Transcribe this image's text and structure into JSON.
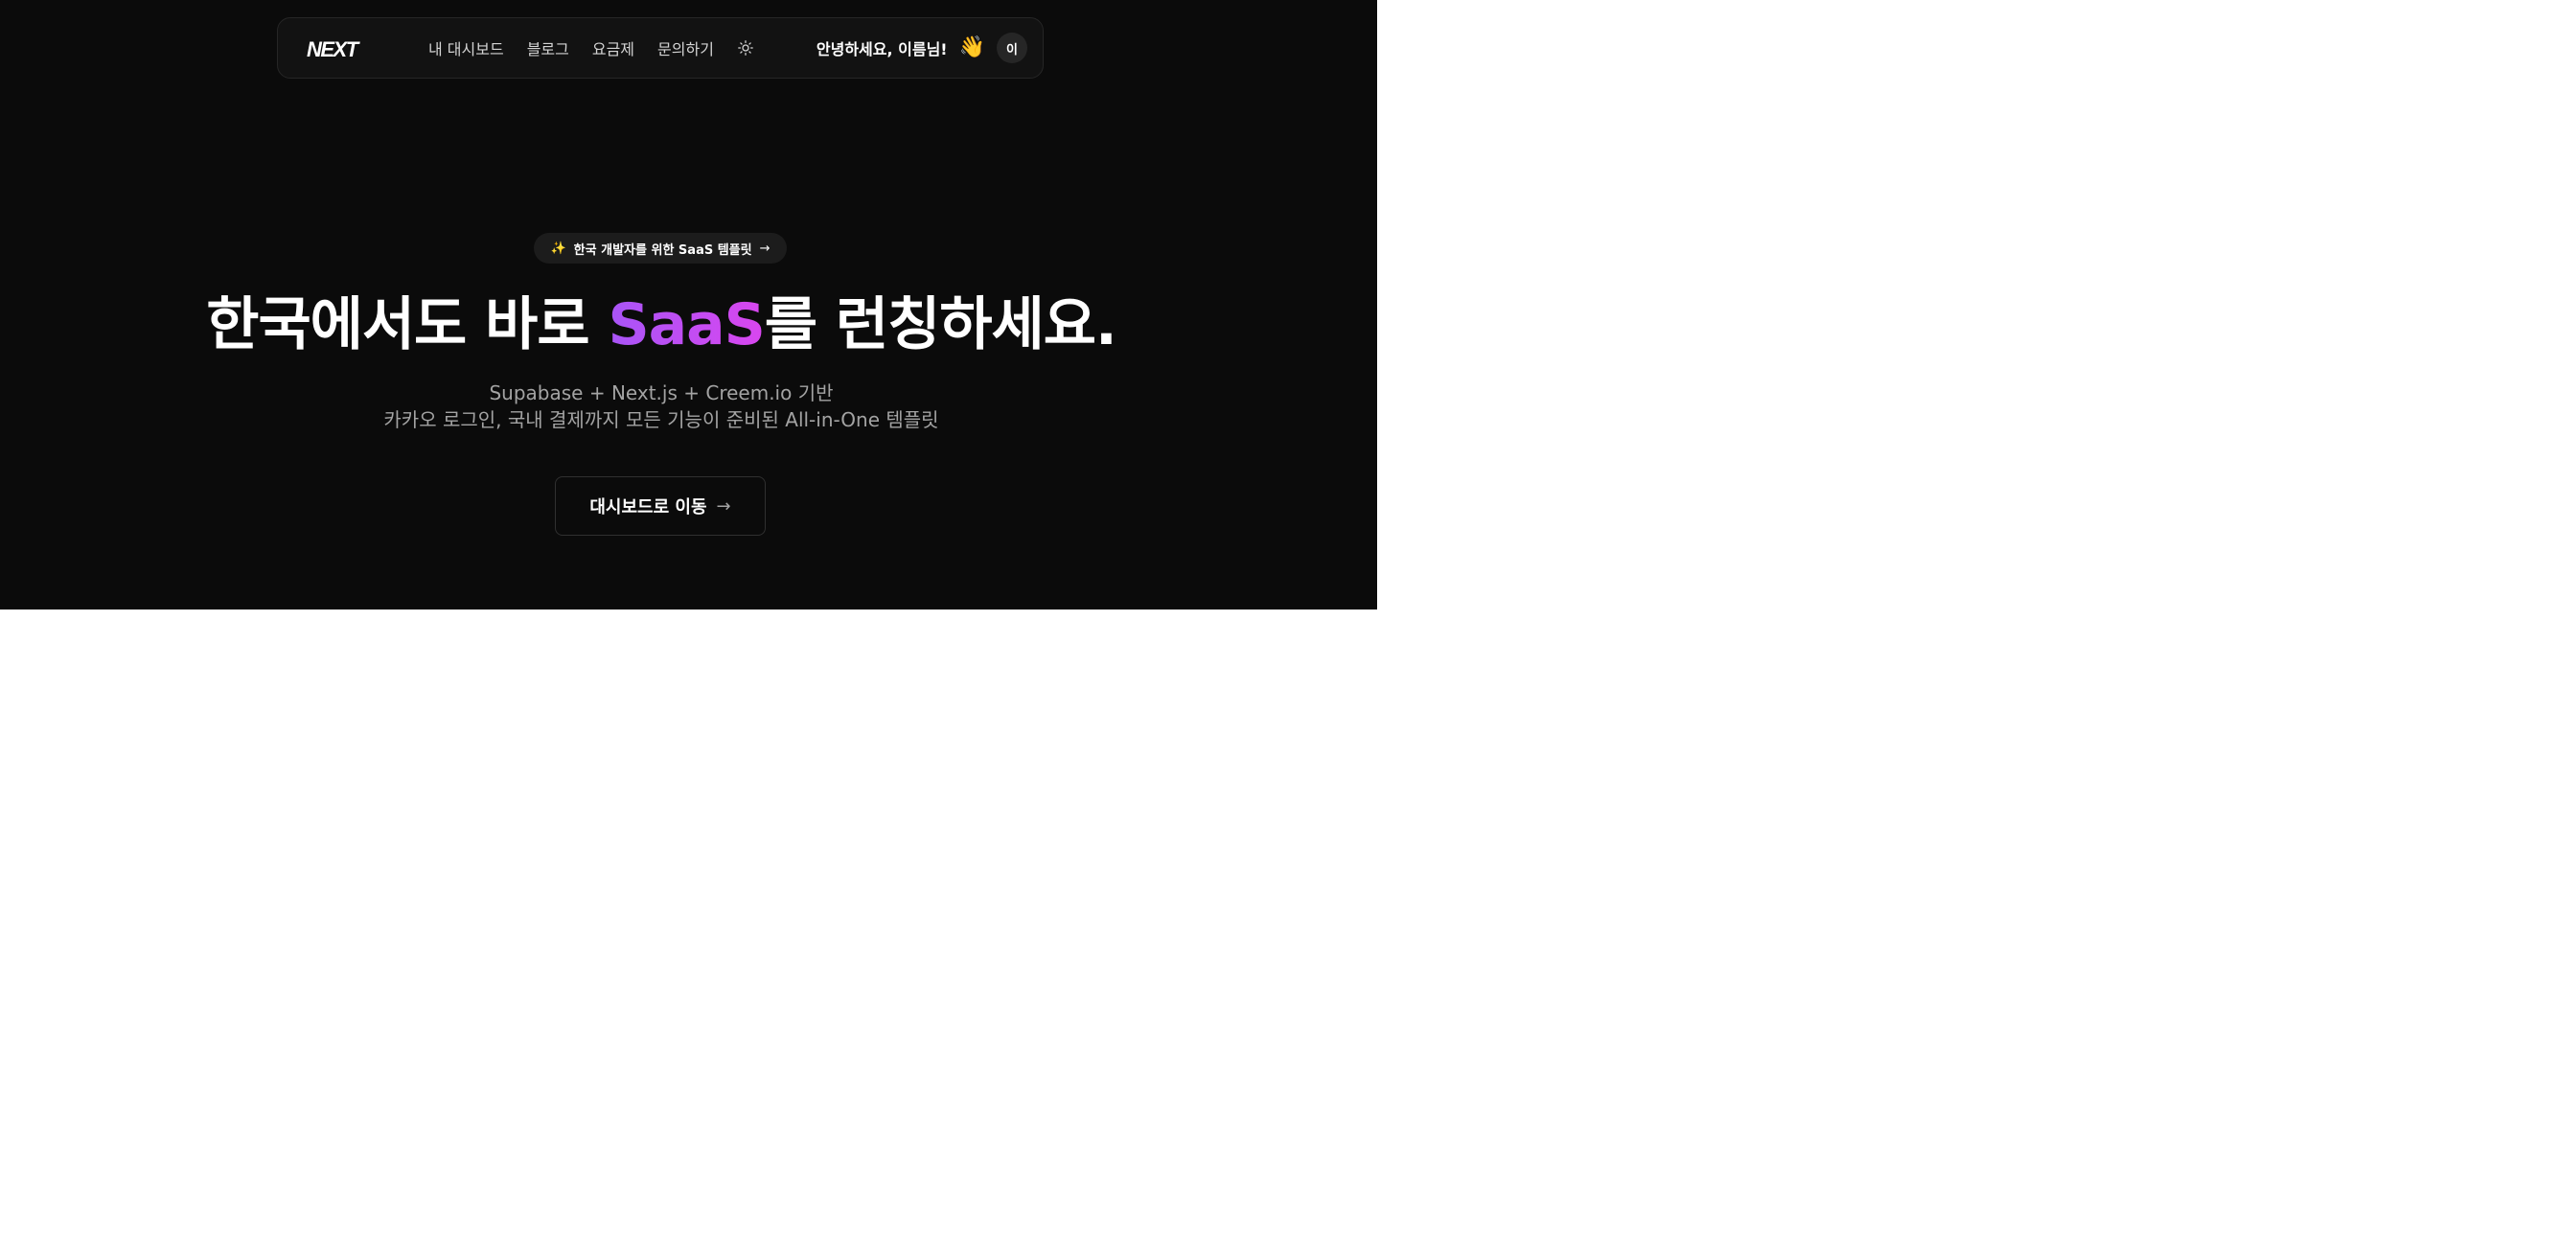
{
  "nav": {
    "logo": "NEXT",
    "links": [
      "내 대시보드",
      "블로그",
      "요금제",
      "문의하기"
    ],
    "theme_icon": "sun-icon",
    "greeting": "안녕하세요, 이름님!",
    "wave_icon": "waving-hand-icon",
    "avatar_initial": "이"
  },
  "hero": {
    "badge": {
      "icon": "sparkles-icon",
      "text": "한국 개발자를 위한 SaaS 템플릿",
      "arrow": "→"
    },
    "headline": {
      "part1": "한국에서도 바로 ",
      "accent": "SaaS",
      "part2": "를 ",
      "strong": "런칭",
      "part3": "하세요."
    },
    "subtitle_line1": "Supabase + Next.js + Creem.io 기반",
    "subtitle_line2": "카카오 로그인, 국내 결제까지 모든 기능이 준비된 All-in-One 템플릿",
    "cta_label": "대시보드로 이동",
    "cta_arrow": "→"
  },
  "colors": {
    "background": "#0b0b0b",
    "accent_start": "#a855f7",
    "accent_end": "#d946ef"
  }
}
